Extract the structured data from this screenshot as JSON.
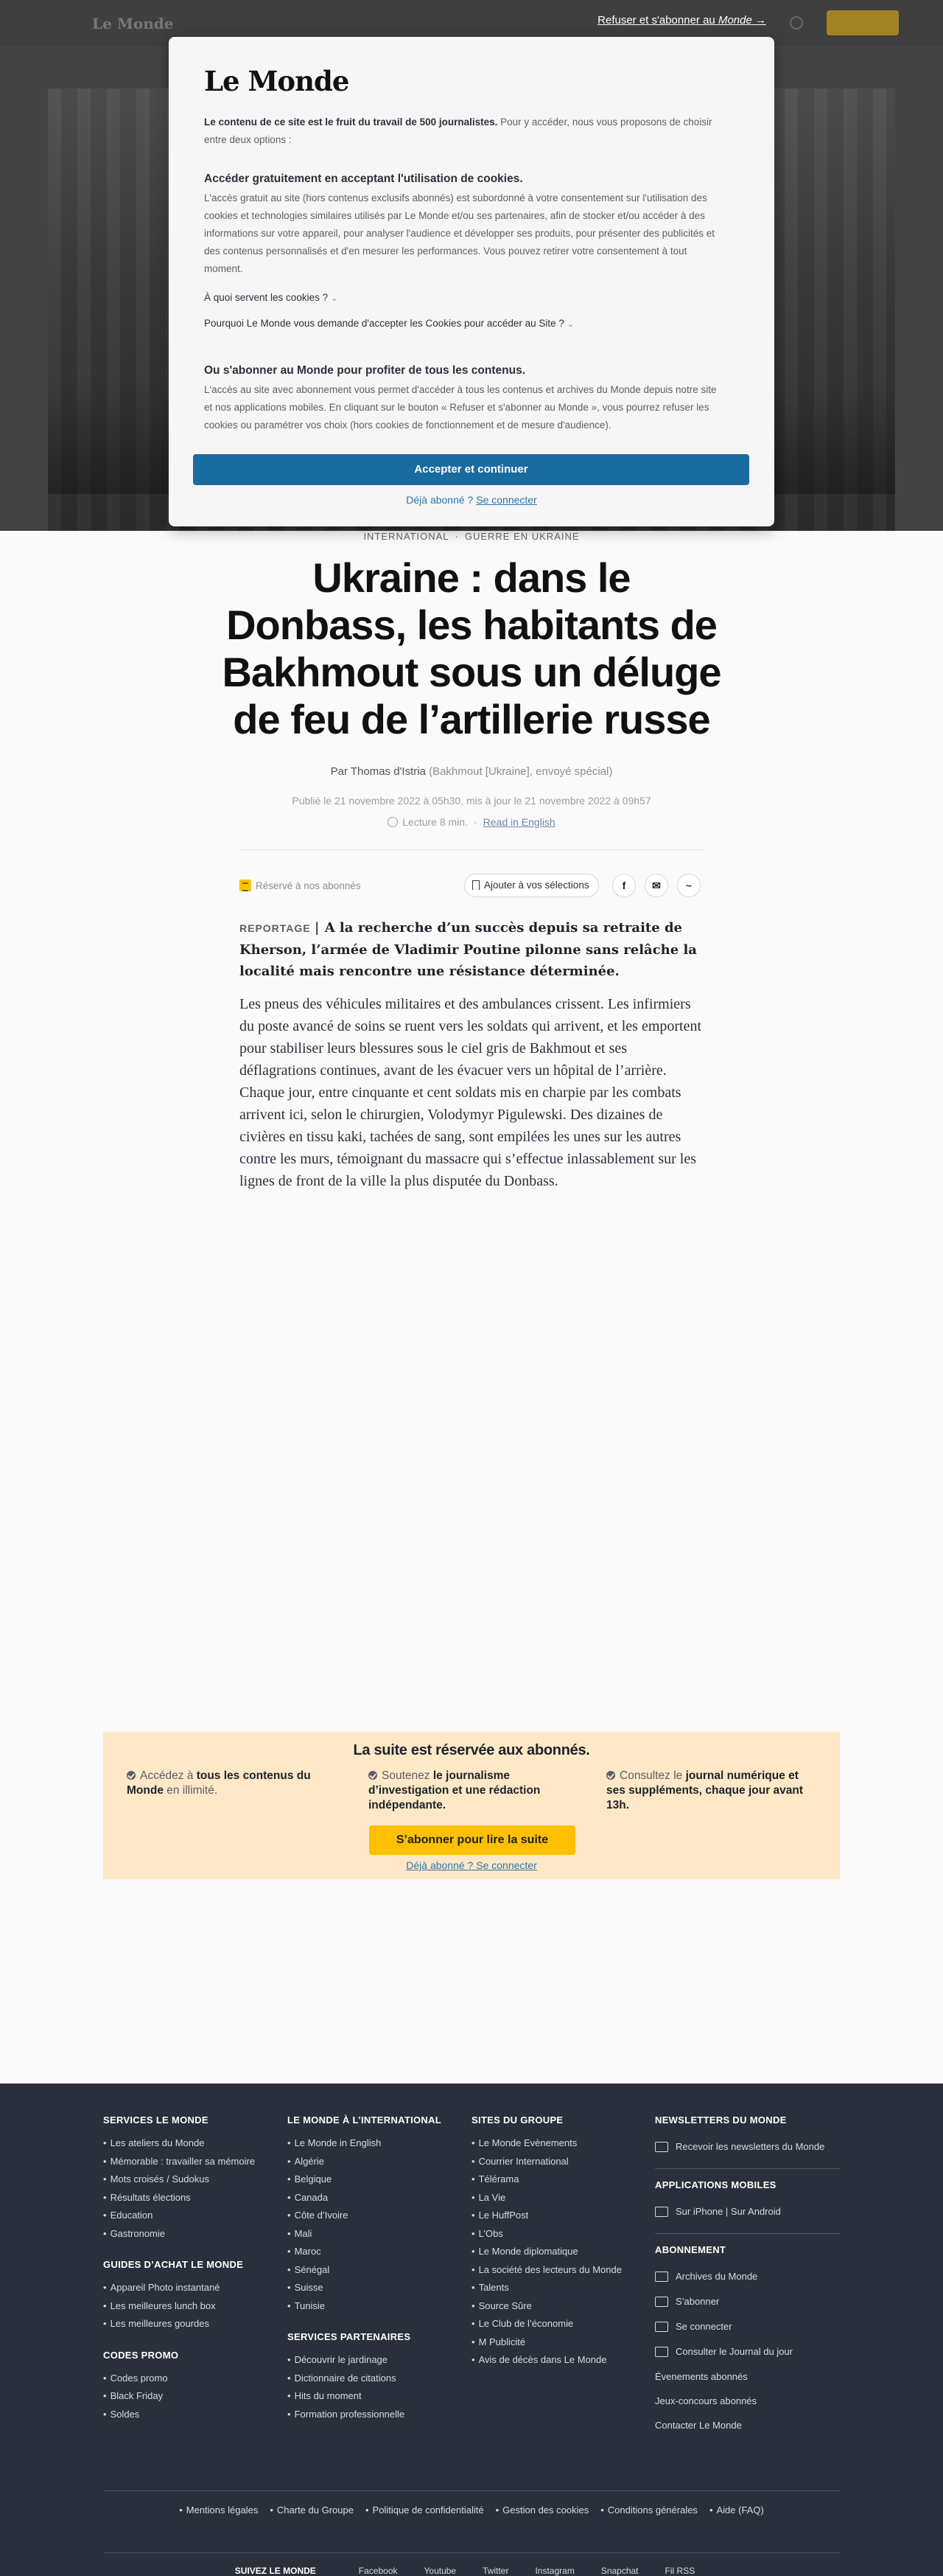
{
  "header": {
    "logo": "Le Monde",
    "refuse_prefix": "Refuser et s'abonner au ",
    "refuse_brand": "Monde",
    "refuse_arrow": " →"
  },
  "modal": {
    "logo": "Le Monde",
    "intro_bold": "Le contenu de ce site est le fruit du travail de 500 journalistes.",
    "intro_rest": " Pour y accéder, nous vous proposons de choisir entre deux options :",
    "option1_title": "Accéder gratuitement en acceptant l'utilisation de cookies.",
    "option1_text": "L'accès gratuit au site (hors contenus exclusifs abonnés) est subordonné à votre consentement sur l'utilisation des cookies et technologies similaires utilisés par Le Monde et/ou ses partenaires, afin de stocker et/ou accéder à des informations sur votre appareil, pour analyser l'audience et développer ses produits, pour présenter des publicités et des contenus personnalisés et d'en mesurer les performances. Vous pouvez retirer votre consentement à tout moment.",
    "q1": "À quoi servent les cookies ?",
    "q2": "Pourquoi Le Monde vous demande d'accepter les Cookies pour accéder au Site ?",
    "option2_title": "Ou s'abonner au Monde pour profiter de tous les contenus.",
    "option2_text": "L'accès au site avec abonnement vous permet d'accéder à tous les contenus et archives du Monde depuis notre site et nos applications mobiles. En cliquant sur le bouton « Refuser et s'abonner au Monde », vous pourrez refuser les cookies ou paramétrer vos choix (hors cookies de fonctionnement et de mesure d'audience).",
    "accept_label": "Accepter et continuer",
    "already_prefix": "Déjà abonné ? ",
    "already_link": "Se connecter"
  },
  "article": {
    "section": "INTERNATIONAL",
    "subsection": "GUERRE EN UKRAINE",
    "title": "Ukraine : dans le Donbass, les habitants de Bakhmout sous un déluge de feu de l’artillerie russe",
    "author": "Par Thomas d'Istria",
    "author_location": "(Bakhmout [Ukraine], envoyé spécial)",
    "dates": "Publié le 21 novembre 2022 à 05h30, mis à jour le 21 novembre 2022 à 09h57",
    "read_time": "Lecture 8 min.",
    "read_english": "Read in English",
    "reserved": "Réservé à nos abonnés",
    "add_selection": "Ajouter à vos sélections",
    "share_facebook": "f",
    "share_mail": "✉",
    "share_messenger": "~",
    "chapo_tag": "REPORTAGE",
    "chapo": "A la recherche d’un succès depuis sa retraite de Kherson, l’armée de Vladimir Poutine pilonne sans relâche la localité mais rencontre une résistance déterminée.",
    "body": "Les pneus des véhicules militaires et des ambulances crissent. Les infirmiers du poste avancé de soins se ruent vers les soldats qui arrivent, et les emportent pour stabiliser leurs blessures sous le ciel gris de Bakhmout et ses déflagrations continues, avant de les évacuer vers un hôpital de l’arrière. Chaque jour, entre cinquante et cent soldats mis en charpie par les combats arrivent ici, selon le chirurgien, Volodymyr Pigulewski. Des dizaines de civières en tissu kaki, tachées de sang, sont empilées les unes sur les autres contre les murs, témoignant du massacre qui s’effectue inlassablement sur les lignes de front de la ville la plus disputée du Donbass."
  },
  "paywall": {
    "title": "La suite est réservée aux abonnés.",
    "col1_a": "Accédez à ",
    "col1_b": "tous les contenus du Monde",
    "col1_c": " en illimité.",
    "col2_a": "Soutenez ",
    "col2_b": "le journalisme d’investigation et une rédaction indépendante.",
    "col3_a": "Consultez le ",
    "col3_b": "journal numérique et ses suppléments, chaque jour avant 13h.",
    "button": "S’abonner pour lire la suite",
    "already": "Déjà abonné ? Se connecter"
  },
  "footer": {
    "services_title": "SERVICES LE MONDE",
    "services": [
      "Les ateliers du Monde",
      "Mémorable : travailler sa mémoire",
      "Mots croisés / Sudokus",
      "Résultats élections",
      "Education",
      "Gastronomie"
    ],
    "guides_title": "GUIDES D’ACHAT LE MONDE",
    "guides": [
      "Appareil Photo instantané",
      "Les meilleures lunch box",
      "Les meilleures gourdes"
    ],
    "codes_title": "CODES PROMO",
    "codes": [
      "Codes promo",
      "Black Friday",
      "Soldes"
    ],
    "intl_title": "LE MONDE À L’INTERNATIONAL",
    "intl": [
      "Le Monde in English",
      "Algérie",
      "Belgique",
      "Canada",
      "Côte d’Ivoire",
      "Mali",
      "Maroc",
      "Sénégal",
      "Suisse",
      "Tunisie"
    ],
    "partners_title": "SERVICES PARTENAIRES",
    "partners": [
      "Découvrir le jardinage",
      "Dictionnaire de citations",
      "Hits du moment",
      "Formation professionnelle"
    ],
    "group_title": "SITES DU GROUPE",
    "group": [
      "Le Monde Evènements",
      "Courrier International",
      "Télérama",
      "La Vie",
      "Le HuffPost",
      "L’Obs",
      "Le Monde diplomatique",
      "La société des lecteurs du Monde",
      "Talents",
      "Source Sûre",
      "Le Club de l’économie",
      "M Publicité",
      "Avis de décès dans Le Monde"
    ],
    "newsletters_title": "NEWSLETTERS DU MONDE",
    "newsletters_item": "Recevoir les newsletters du Monde",
    "apps_title": "APPLICATIONS MOBILES",
    "apps_item": "Sur iPhone | Sur Android",
    "subscription_title": "ABONNEMENT",
    "sub_archives": "Archives du Monde",
    "sub_subscribe": "S’abonner",
    "sub_login": "Se connecter",
    "sub_journal": "Consulter le Journal du jour",
    "sub_events": "Évenements abonnés",
    "sub_contests": "Jeux-concours abonnés",
    "sub_contact": "Contacter Le Monde",
    "legal": [
      "Mentions légales",
      "Charte du Groupe",
      "Politique de confidentialité",
      "Gestion des cookies",
      "Conditions générales",
      "Aide (FAQ)"
    ],
    "social_title": "SUIVEZ LE MONDE",
    "social": [
      "Facebook",
      "Youtube",
      "Twitter",
      "Instagram",
      "Snapchat",
      "Fil RSS"
    ]
  }
}
